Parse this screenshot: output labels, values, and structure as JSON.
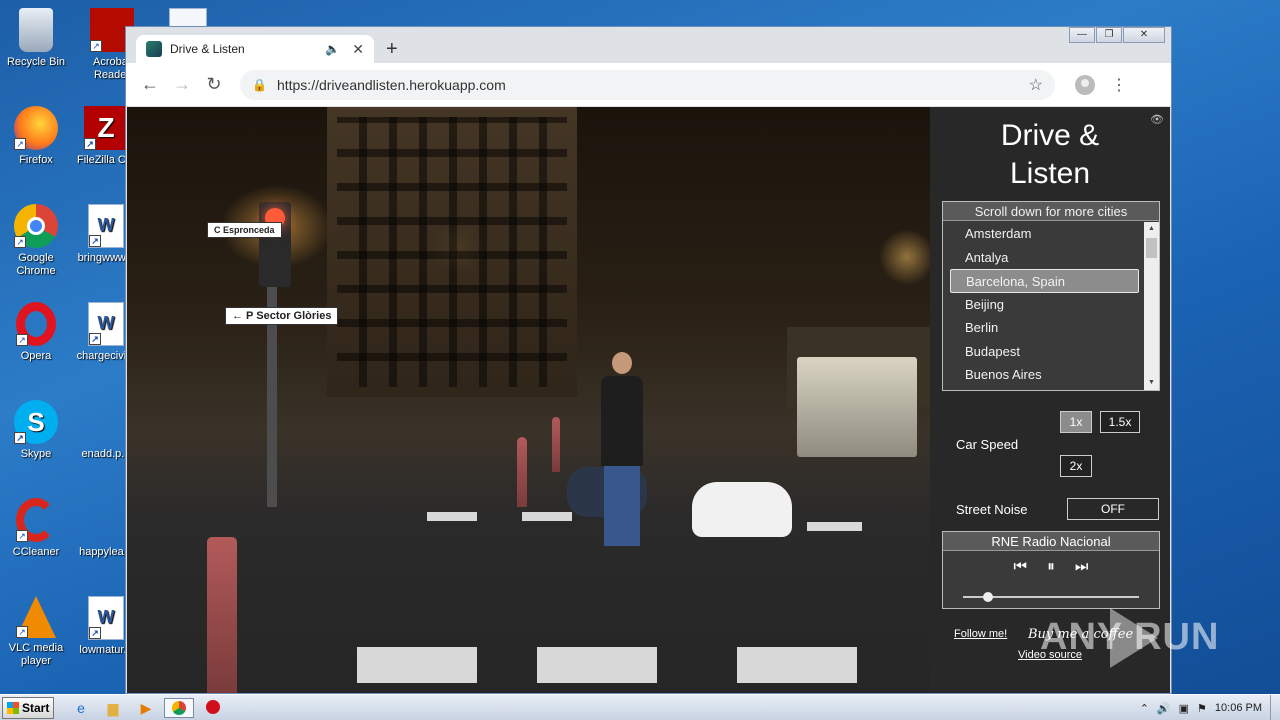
{
  "desktop": {
    "icons": [
      {
        "label": "Recycle Bin",
        "glyph": "🗑"
      },
      {
        "label": "Acrobat Reader",
        "glyph": "A"
      },
      {
        "label": "Firefox",
        "glyph": "🦊"
      },
      {
        "label": "FileZilla C...",
        "glyph": "Z"
      },
      {
        "label": "Google Chrome",
        "glyph": "◎"
      },
      {
        "label": "bringwww...",
        "glyph": "W"
      },
      {
        "label": "Opera",
        "glyph": "O"
      },
      {
        "label": "chargecivi...",
        "glyph": "W"
      },
      {
        "label": "Skype",
        "glyph": "S"
      },
      {
        "label": "enadd.p...",
        "glyph": ""
      },
      {
        "label": "CCleaner",
        "glyph": "C"
      },
      {
        "label": "happylea...",
        "glyph": ""
      },
      {
        "label": "VLC media player",
        "glyph": "▲"
      },
      {
        "label": "lowmatur...",
        "glyph": "W"
      }
    ]
  },
  "browser": {
    "tab_title": "Drive & Listen",
    "tab_audio_icon": "speaker-icon",
    "new_tab": "+",
    "url": "https://driveandlisten.herokuapp.com",
    "window_controls": {
      "minimize": "—",
      "restore": "❐",
      "close": "✕"
    }
  },
  "app": {
    "title_line1": "Drive &",
    "title_line2": "Listen",
    "city_header": "Scroll down for more cities",
    "cities": [
      "Amsterdam",
      "Antalya",
      "Barcelona, Spain",
      "Beijing",
      "Berlin",
      "Budapest",
      "Buenos Aires"
    ],
    "selected_city": "Barcelona, Spain",
    "car_speed_label": "Car Speed",
    "speed_options": [
      "1x",
      "1.5x",
      "2x"
    ],
    "selected_speed": "1x",
    "street_noise_label": "Street Noise",
    "street_noise_value": "OFF",
    "radio_station": "RNE Radio Nacional",
    "volume": 0.14,
    "follow_link": "Follow me!",
    "coffee_link": "Buy me a coffee",
    "video_source_link": "Video source"
  },
  "scene": {
    "sign_top": "C Espronceda",
    "sign_sector": "← P Sector Glòries"
  },
  "watermark": "ANY RUN",
  "taskbar": {
    "start_label": "Start",
    "clock": "10:06 PM"
  }
}
